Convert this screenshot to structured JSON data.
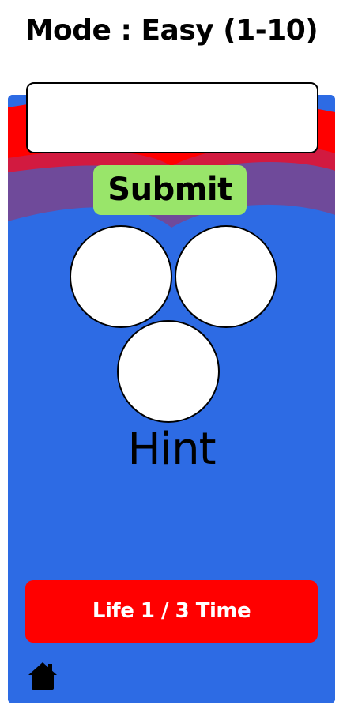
{
  "header": {
    "title": "Mode : Easy (1-10)"
  },
  "answer_input": {
    "value": "",
    "placeholder": ""
  },
  "buttons": {
    "submit_label": "Submit",
    "life_label": "Life 1 / 3 Time"
  },
  "hint": {
    "label": "Hint"
  },
  "icons": {
    "home": "home-icon"
  },
  "colors": {
    "panel_blue": "#2d6be4",
    "wave_red": "#ff0000",
    "wave_crimson": "#d21a40",
    "wave_purple": "#6f4a9a",
    "submit_green": "#99e56a",
    "life_red": "#ff0000"
  }
}
